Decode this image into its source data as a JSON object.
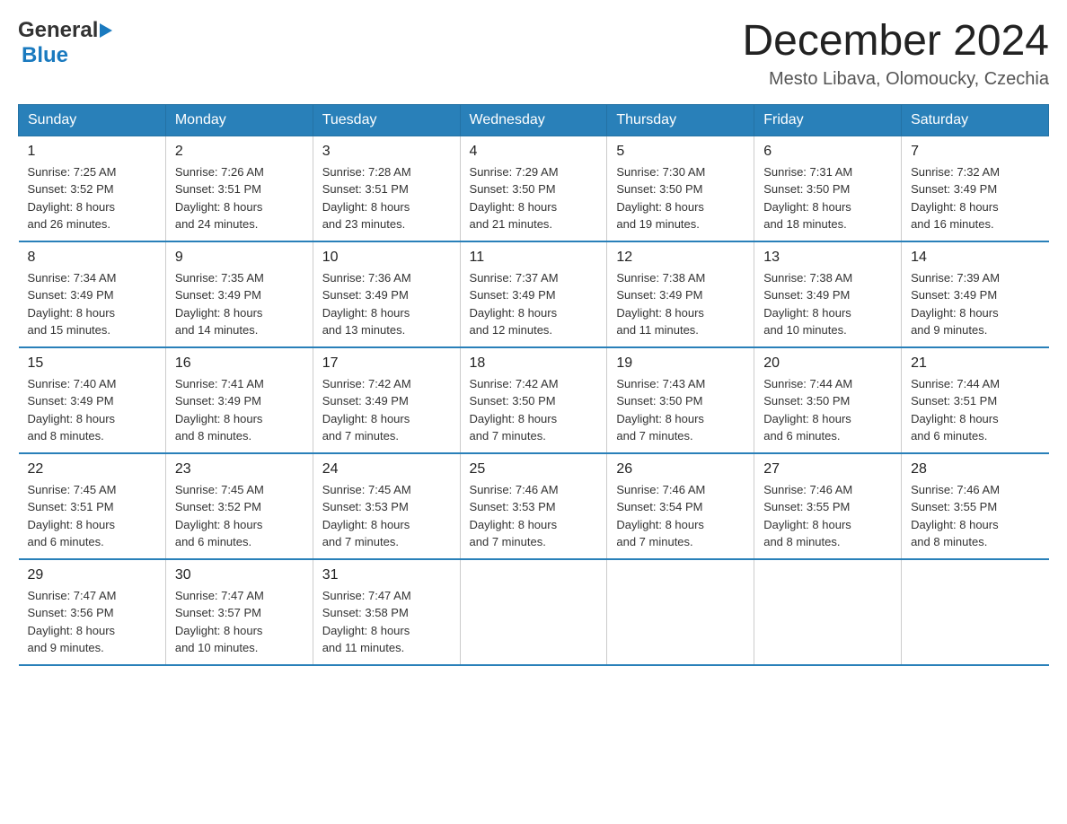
{
  "header": {
    "logo_general": "General",
    "logo_blue": "Blue",
    "month_title": "December 2024",
    "location": "Mesto Libava, Olomoucky, Czechia"
  },
  "days_of_week": [
    "Sunday",
    "Monday",
    "Tuesday",
    "Wednesday",
    "Thursday",
    "Friday",
    "Saturday"
  ],
  "weeks": [
    [
      {
        "day": "1",
        "sunrise": "7:25 AM",
        "sunset": "3:52 PM",
        "daylight": "8 hours and 26 minutes."
      },
      {
        "day": "2",
        "sunrise": "7:26 AM",
        "sunset": "3:51 PM",
        "daylight": "8 hours and 24 minutes."
      },
      {
        "day": "3",
        "sunrise": "7:28 AM",
        "sunset": "3:51 PM",
        "daylight": "8 hours and 23 minutes."
      },
      {
        "day": "4",
        "sunrise": "7:29 AM",
        "sunset": "3:50 PM",
        "daylight": "8 hours and 21 minutes."
      },
      {
        "day": "5",
        "sunrise": "7:30 AM",
        "sunset": "3:50 PM",
        "daylight": "8 hours and 19 minutes."
      },
      {
        "day": "6",
        "sunrise": "7:31 AM",
        "sunset": "3:50 PM",
        "daylight": "8 hours and 18 minutes."
      },
      {
        "day": "7",
        "sunrise": "7:32 AM",
        "sunset": "3:49 PM",
        "daylight": "8 hours and 16 minutes."
      }
    ],
    [
      {
        "day": "8",
        "sunrise": "7:34 AM",
        "sunset": "3:49 PM",
        "daylight": "8 hours and 15 minutes."
      },
      {
        "day": "9",
        "sunrise": "7:35 AM",
        "sunset": "3:49 PM",
        "daylight": "8 hours and 14 minutes."
      },
      {
        "day": "10",
        "sunrise": "7:36 AM",
        "sunset": "3:49 PM",
        "daylight": "8 hours and 13 minutes."
      },
      {
        "day": "11",
        "sunrise": "7:37 AM",
        "sunset": "3:49 PM",
        "daylight": "8 hours and 12 minutes."
      },
      {
        "day": "12",
        "sunrise": "7:38 AM",
        "sunset": "3:49 PM",
        "daylight": "8 hours and 11 minutes."
      },
      {
        "day": "13",
        "sunrise": "7:38 AM",
        "sunset": "3:49 PM",
        "daylight": "8 hours and 10 minutes."
      },
      {
        "day": "14",
        "sunrise": "7:39 AM",
        "sunset": "3:49 PM",
        "daylight": "8 hours and 9 minutes."
      }
    ],
    [
      {
        "day": "15",
        "sunrise": "7:40 AM",
        "sunset": "3:49 PM",
        "daylight": "8 hours and 8 minutes."
      },
      {
        "day": "16",
        "sunrise": "7:41 AM",
        "sunset": "3:49 PM",
        "daylight": "8 hours and 8 minutes."
      },
      {
        "day": "17",
        "sunrise": "7:42 AM",
        "sunset": "3:49 PM",
        "daylight": "8 hours and 7 minutes."
      },
      {
        "day": "18",
        "sunrise": "7:42 AM",
        "sunset": "3:50 PM",
        "daylight": "8 hours and 7 minutes."
      },
      {
        "day": "19",
        "sunrise": "7:43 AM",
        "sunset": "3:50 PM",
        "daylight": "8 hours and 7 minutes."
      },
      {
        "day": "20",
        "sunrise": "7:44 AM",
        "sunset": "3:50 PM",
        "daylight": "8 hours and 6 minutes."
      },
      {
        "day": "21",
        "sunrise": "7:44 AM",
        "sunset": "3:51 PM",
        "daylight": "8 hours and 6 minutes."
      }
    ],
    [
      {
        "day": "22",
        "sunrise": "7:45 AM",
        "sunset": "3:51 PM",
        "daylight": "8 hours and 6 minutes."
      },
      {
        "day": "23",
        "sunrise": "7:45 AM",
        "sunset": "3:52 PM",
        "daylight": "8 hours and 6 minutes."
      },
      {
        "day": "24",
        "sunrise": "7:45 AM",
        "sunset": "3:53 PM",
        "daylight": "8 hours and 7 minutes."
      },
      {
        "day": "25",
        "sunrise": "7:46 AM",
        "sunset": "3:53 PM",
        "daylight": "8 hours and 7 minutes."
      },
      {
        "day": "26",
        "sunrise": "7:46 AM",
        "sunset": "3:54 PM",
        "daylight": "8 hours and 7 minutes."
      },
      {
        "day": "27",
        "sunrise": "7:46 AM",
        "sunset": "3:55 PM",
        "daylight": "8 hours and 8 minutes."
      },
      {
        "day": "28",
        "sunrise": "7:46 AM",
        "sunset": "3:55 PM",
        "daylight": "8 hours and 8 minutes."
      }
    ],
    [
      {
        "day": "29",
        "sunrise": "7:47 AM",
        "sunset": "3:56 PM",
        "daylight": "8 hours and 9 minutes."
      },
      {
        "day": "30",
        "sunrise": "7:47 AM",
        "sunset": "3:57 PM",
        "daylight": "8 hours and 10 minutes."
      },
      {
        "day": "31",
        "sunrise": "7:47 AM",
        "sunset": "3:58 PM",
        "daylight": "8 hours and 11 minutes."
      },
      null,
      null,
      null,
      null
    ]
  ],
  "labels": {
    "sunrise": "Sunrise:",
    "sunset": "Sunset:",
    "daylight": "Daylight:"
  }
}
